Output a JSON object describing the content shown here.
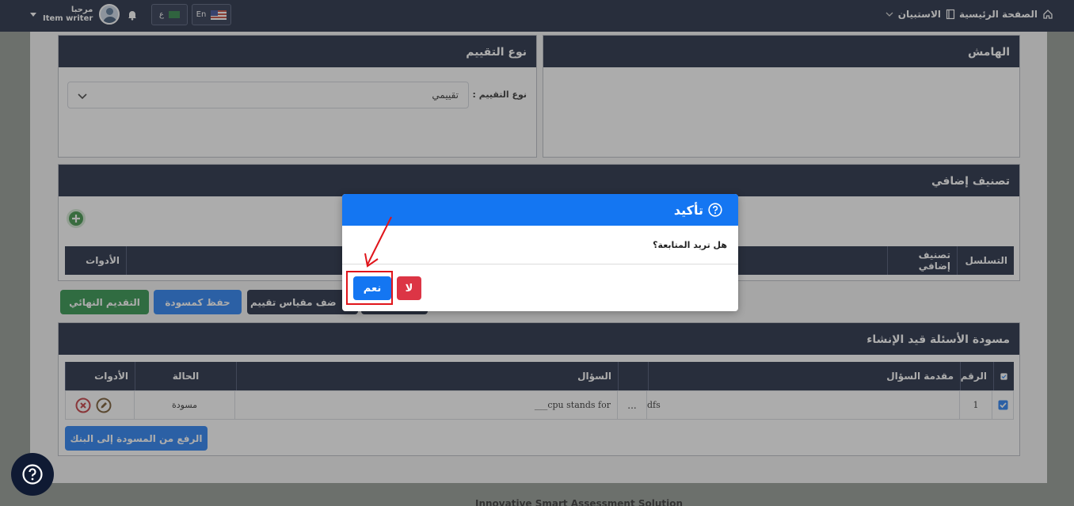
{
  "navbar": {
    "home_label": "الصفحة الرئيسية",
    "survey_label": "الاستبيان",
    "lang_en": "En",
    "lang_ar": "ع",
    "greeting": "مرحبا",
    "role": "Item writer"
  },
  "margin_card": {
    "title": "الهامش"
  },
  "eval_card": {
    "title": "نوع التقييم",
    "field_label": "نوع التقييم :",
    "field_value": "تقييمي"
  },
  "extra_card": {
    "title": "تصنيف إضافي",
    "columns": [
      "التسلسل",
      "تصنيف إضافي",
      "الأدوات"
    ]
  },
  "actions": {
    "final_submit": "التقديم النهائي",
    "save_draft": "حفظ كمسودة",
    "add_rubric": "ضف مقياس تقييم"
  },
  "drafts_card": {
    "title": "مسودة الأسئلة قيد الإنشاء",
    "columns": [
      "الرقم",
      "مقدمة السؤال",
      "",
      "السؤال",
      "الحالة",
      "الأدوات"
    ],
    "rows": [
      {
        "number": "1",
        "intro": "dfs",
        "more": "...",
        "question": "___cpu stands for",
        "status": "مسودة"
      }
    ],
    "upload_button": "الرفع من المسودة إلى البنك"
  },
  "modal": {
    "title": "تأكيد",
    "message": "هل تريد المتابعة؟",
    "yes_label": "نعم",
    "no_label": "لا"
  },
  "footer_text": "Innovative Smart Assessment Solution",
  "colors": {
    "navy": "#0f1a33",
    "primary": "#1476f2",
    "success": "#1e8a3c",
    "danger": "#dc3545",
    "annotation_red": "#e0151b"
  }
}
